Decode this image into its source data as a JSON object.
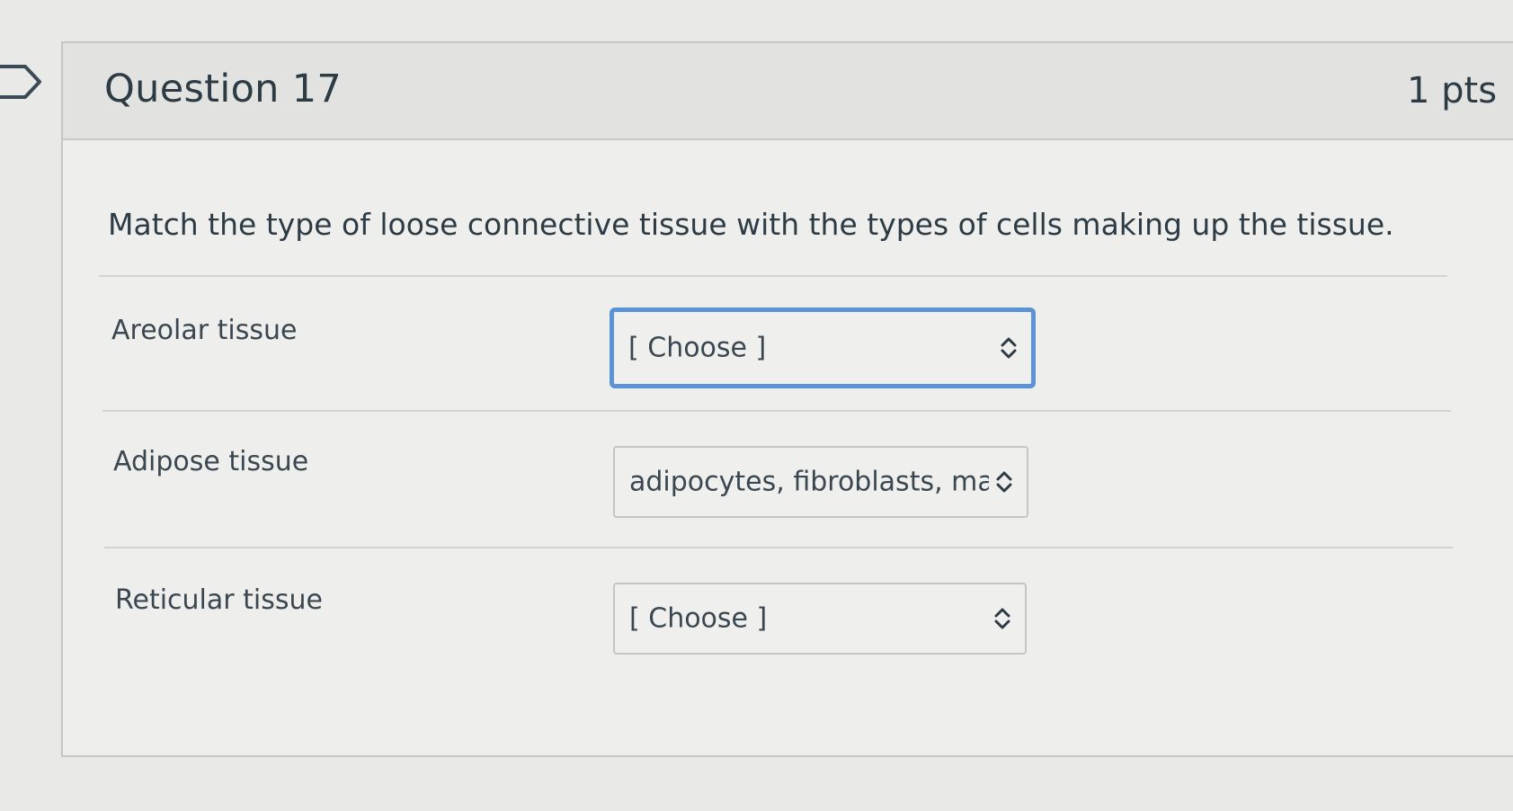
{
  "question": {
    "title": "Question 17",
    "points": "1 pts",
    "prompt": "Match the type of loose connective tissue with the types of cells making up the tissue."
  },
  "rows": [
    {
      "label": "Areolar tissue",
      "selected": "[ Choose ]",
      "focused": true
    },
    {
      "label": "Adipose tissue",
      "selected": "adipocytes, fibroblasts, macroph",
      "focused": false
    },
    {
      "label": "Reticular tissue",
      "selected": "[ Choose ]",
      "focused": false
    }
  ],
  "icons": {
    "flag": "bookmark-flag-icon",
    "select": "chevron-up-down-icon"
  },
  "colors": {
    "focus_ring": "#5b93d6",
    "text": "#2d3b45"
  }
}
